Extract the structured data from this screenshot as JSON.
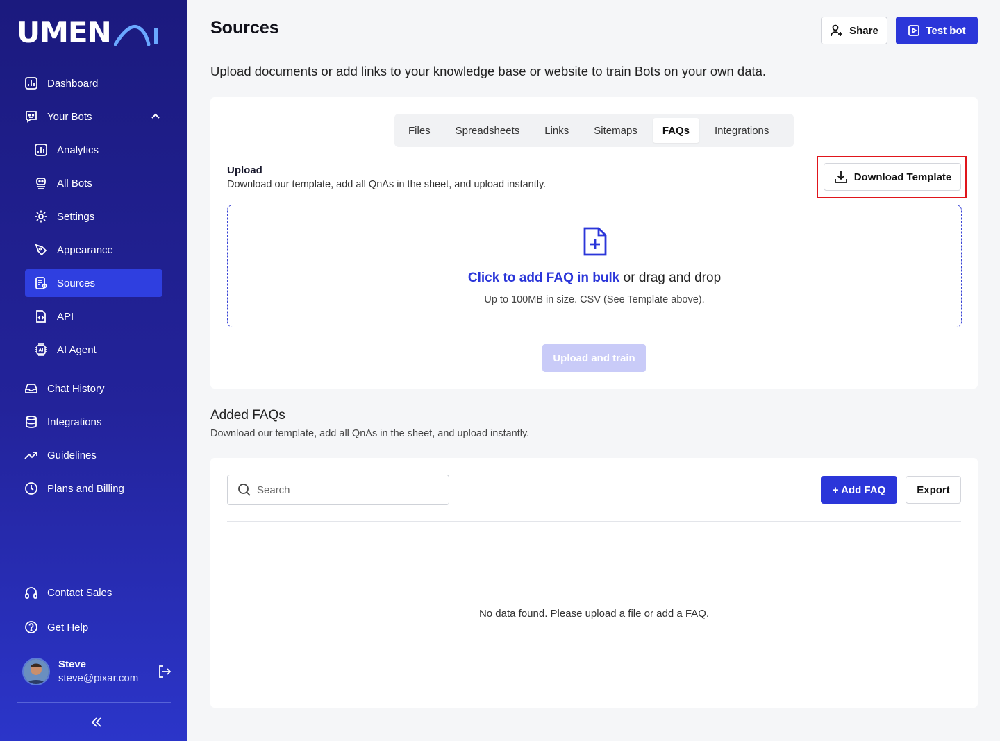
{
  "brand": {
    "logo_text": "UMEN",
    "logo_suffix": "AI"
  },
  "sidebar": {
    "items": [
      {
        "label": "Dashboard",
        "icon": "chart-icon"
      },
      {
        "label": "Your Bots",
        "icon": "bot-icon"
      },
      {
        "label": "Analytics",
        "icon": "chart-icon"
      },
      {
        "label": "All Bots",
        "icon": "bot-icon"
      },
      {
        "label": "Settings",
        "icon": "gear-icon"
      },
      {
        "label": "Appearance",
        "icon": "pen-icon"
      },
      {
        "label": "Sources",
        "icon": "document-icon",
        "active": true
      },
      {
        "label": "API",
        "icon": "code-file-icon"
      },
      {
        "label": "AI Agent",
        "icon": "chip-icon"
      },
      {
        "label": "Chat History",
        "icon": "inbox-icon"
      },
      {
        "label": "Integrations",
        "icon": "database-icon"
      },
      {
        "label": "Guidelines",
        "icon": "trend-icon"
      },
      {
        "label": "Plans and Billing",
        "icon": "clock-icon"
      }
    ],
    "contact_sales": "Contact Sales",
    "get_help": "Get Help",
    "user": {
      "name": "Steve",
      "email": "steve@pixar.com"
    }
  },
  "header": {
    "title": "Sources",
    "share_label": "Share",
    "test_label": "Test bot",
    "description": "Upload documents or add links to your knowledge base or website to train Bots on your own data."
  },
  "tabs": [
    "Files",
    "Spreadsheets",
    "Links",
    "Sitemaps",
    "FAQs",
    "Integrations"
  ],
  "active_tab": "FAQs",
  "upload": {
    "title": "Upload",
    "description": "Download our template, add all QnAs in the sheet, and upload instantly.",
    "download_label": "Download Template",
    "drop_link": "Click to add FAQ in bulk",
    "drop_rest": " or drag and drop",
    "drop_sub": "Up to 100MB in size. CSV (See Template above).",
    "train_label": "Upload and train"
  },
  "faqs": {
    "title": "Added FAQs",
    "description": "Download our template, add all QnAs in the sheet, and upload instantly.",
    "search_placeholder": "Search",
    "add_label": "+ Add FAQ",
    "export_label": "Export",
    "empty_text": "No data found. Please upload a file or add a FAQ."
  },
  "colors": {
    "accent": "#2b36d9",
    "sidebar": "#1b1a7e",
    "highlight": "#e0151b"
  }
}
